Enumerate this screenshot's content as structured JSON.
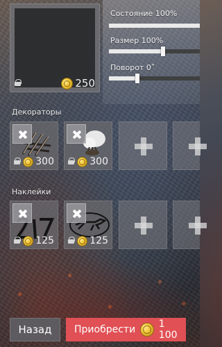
{
  "preview": {
    "price": "250"
  },
  "sliders": [
    {
      "label": "Состояние 100%",
      "value_percent": 100
    },
    {
      "label": "Размер 100%",
      "value_percent": 100
    },
    {
      "label": "Поворот 0˚",
      "value_percent": 0
    }
  ],
  "decorators": {
    "title": "Декораторы",
    "items": [
      {
        "price": "300",
        "icon": "barbed-wire-decorator"
      },
      {
        "price": "300",
        "icon": "white-bush-decorator"
      }
    ]
  },
  "stickers": {
    "title": "Наклейки",
    "items": [
      {
        "price": "125",
        "icon": "number-217-sticker"
      },
      {
        "price": "125",
        "icon": "running-dog-sticker"
      }
    ]
  },
  "footer": {
    "back_label": "Назад",
    "buy_label": "Приобрести",
    "buy_price": "1 100"
  },
  "colors": {
    "buy_button": "#e05055",
    "coin": "#f1c233"
  }
}
